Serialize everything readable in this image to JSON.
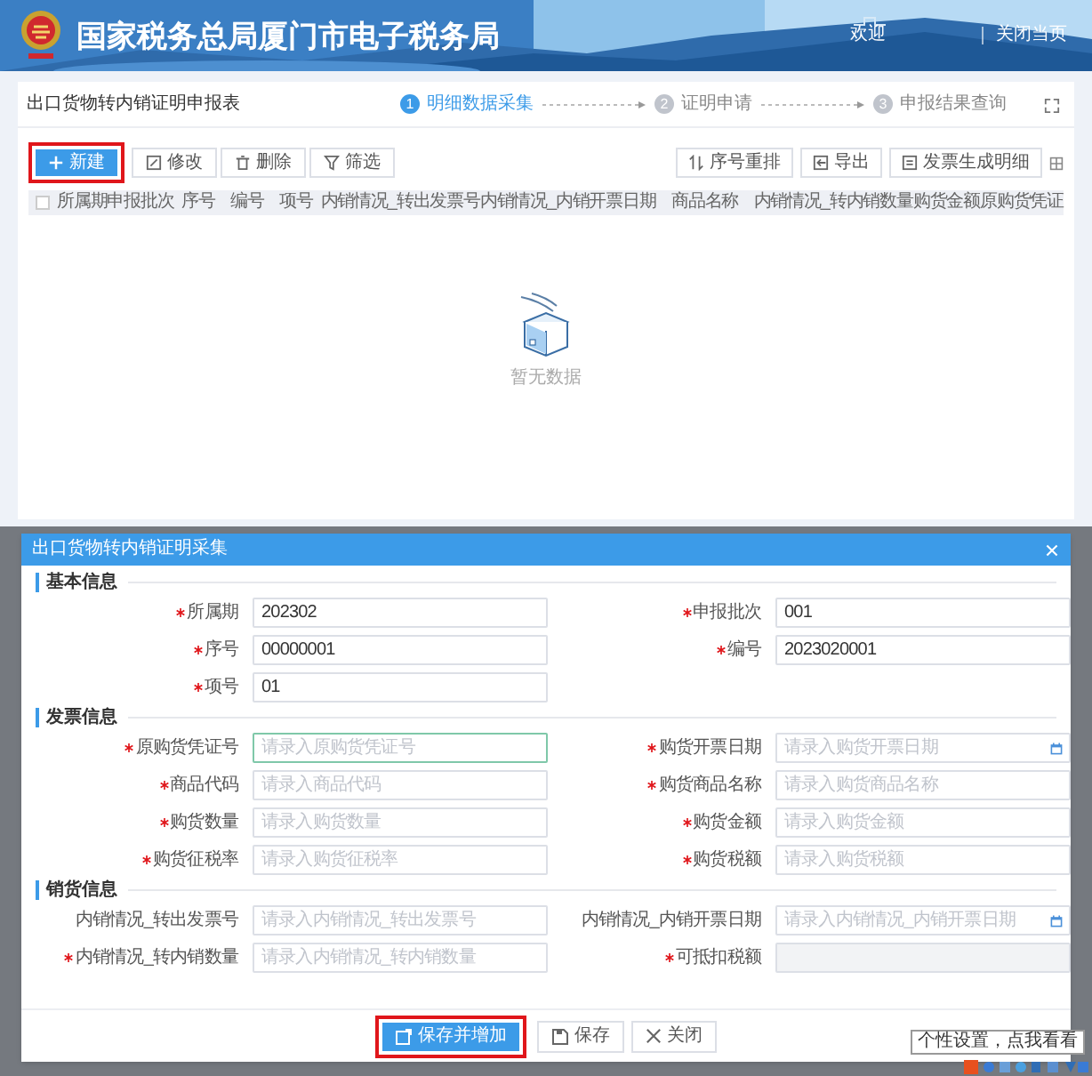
{
  "top_screen": {
    "banner": {
      "title": "国家税务总局厦门市电子税务局",
      "welcome": "欢迎",
      "close_page": "关闭当页"
    },
    "page_title": "出口货物转内销证明申报表",
    "steps": [
      {
        "number": "1",
        "label": "明细数据采集",
        "selected": true
      },
      {
        "number": "2",
        "label": "证明申请",
        "selected": false
      },
      {
        "number": "3",
        "label": "申报结果查询",
        "selected": false
      }
    ],
    "toolbar_left": [
      {
        "label": "新建",
        "kind": "add",
        "primary": true,
        "highlighted": true
      },
      {
        "label": "修改",
        "kind": "edit",
        "primary": false,
        "highlighted": false
      },
      {
        "label": "删除",
        "kind": "delete",
        "primary": false,
        "highlighted": false
      },
      {
        "label": "筛选",
        "kind": "filter",
        "primary": false,
        "highlighted": false
      }
    ],
    "toolbar_right": [
      {
        "label": "序号重排",
        "kind": "sort"
      },
      {
        "label": "导出",
        "kind": "export"
      },
      {
        "label": "发票生成明细",
        "kind": "generate"
      }
    ],
    "table": {
      "header_checkbox": {
        "checked": false
      },
      "columns": [
        "所属期",
        "申报批次",
        "序号",
        "编号",
        "项号",
        "内销情况_转出发票号",
        "内销情况_内销开票日期",
        "商品名称",
        "内销情况_转内销数量",
        "购货金额",
        "原购货凭证"
      ],
      "empty_text": "暂无数据"
    }
  },
  "bottom_screen": {
    "dialog": {
      "title": "出口货物转内销证明采集",
      "sections": [
        {
          "title": "基本信息",
          "fields": [
            {
              "label": "所属期",
              "required": true,
              "kind": "text",
              "value": "202302"
            },
            {
              "label": "申报批次",
              "required": true,
              "kind": "text",
              "value": "001"
            },
            {
              "label": "序号",
              "required": true,
              "kind": "text",
              "value": "00000001"
            },
            {
              "label": "编号",
              "required": true,
              "kind": "text",
              "value": "2023020001"
            },
            {
              "label": "项号",
              "required": true,
              "kind": "text",
              "value": "01"
            }
          ]
        },
        {
          "title": "发票信息",
          "fields": [
            {
              "label": "原购货凭证号",
              "required": true,
              "kind": "text",
              "placeholder": "请录入原购货凭证号",
              "focused": true
            },
            {
              "label": "购货开票日期",
              "required": true,
              "kind": "date",
              "placeholder": "请录入购货开票日期"
            },
            {
              "label": "商品代码",
              "required": true,
              "kind": "text",
              "placeholder": "请录入商品代码"
            },
            {
              "label": "购货商品名称",
              "required": true,
              "kind": "text",
              "placeholder": "请录入购货商品名称"
            },
            {
              "label": "购货数量",
              "required": true,
              "kind": "text",
              "placeholder": "请录入购货数量"
            },
            {
              "label": "购货金额",
              "required": true,
              "kind": "text",
              "placeholder": "请录入购货金额"
            },
            {
              "label": "购货征税率",
              "required": true,
              "kind": "text",
              "placeholder": "请录入购货征税率"
            },
            {
              "label": "购货税额",
              "required": true,
              "kind": "text",
              "placeholder": "请录入购货税额"
            }
          ]
        },
        {
          "title": "销货信息",
          "fields": [
            {
              "label": "内销情况_转出发票号",
              "required": false,
              "kind": "text",
              "placeholder": "请录入内销情况_转出发票号"
            },
            {
              "label": "内销情况_内销开票日期",
              "required": false,
              "kind": "date",
              "placeholder": "请录入内销情况_内销开票日期"
            },
            {
              "label": "内销情况_转内销数量",
              "required": true,
              "kind": "text",
              "placeholder": "请录入内销情况_转内销数量"
            },
            {
              "label": "可抵扣税额",
              "required": true,
              "kind": "text",
              "disabled": true
            }
          ]
        }
      ],
      "buttons": [
        {
          "label": "保存并增加",
          "kind": "save_add",
          "primary": true,
          "highlighted": true
        },
        {
          "label": "保存",
          "kind": "save",
          "primary": false,
          "highlighted": false
        },
        {
          "label": "关闭",
          "kind": "close",
          "primary": false,
          "highlighted": false
        }
      ]
    },
    "tooltip": "个性设置，点我看看"
  }
}
